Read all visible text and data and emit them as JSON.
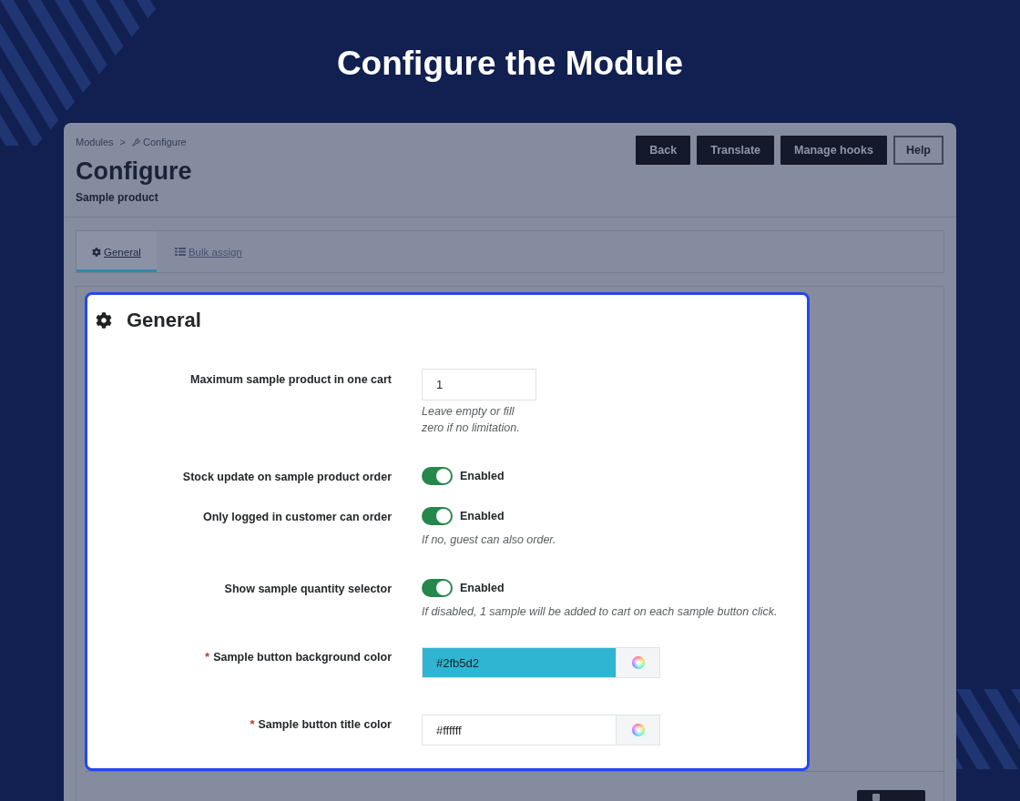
{
  "page": {
    "title": "Configure the Module"
  },
  "header": {
    "breadcrumb": [
      {
        "label": "Modules"
      },
      {
        "label": "Configure"
      }
    ],
    "separator": ">",
    "title": "Configure",
    "subtitle": "Sample product"
  },
  "toolbar": [
    {
      "label": "Back",
      "kind": "solid"
    },
    {
      "label": "Translate",
      "kind": "solid"
    },
    {
      "label": "Manage hooks",
      "kind": "solid"
    },
    {
      "label": "Help",
      "kind": "outline"
    }
  ],
  "tabs": [
    {
      "label": "General",
      "selected": true
    },
    {
      "label": "Bulk assign",
      "selected": false
    }
  ],
  "panel": {
    "title": "General",
    "fields": [
      {
        "kind": "number",
        "label": "Maximum sample product in one cart",
        "value": "1",
        "help": "Leave empty or fill zero if no limitation."
      },
      {
        "kind": "switch",
        "label": "Stock update on sample product order",
        "on": true,
        "state_label": "Enabled"
      },
      {
        "kind": "switch",
        "label": "Only logged in customer can order",
        "on": true,
        "state_label": "Enabled",
        "help": "If no, guest can also order."
      },
      {
        "kind": "switch",
        "label": "Show sample quantity selector",
        "on": true,
        "state_label": "Enabled",
        "help": "If disabled, 1 sample will be added to cart on each sample button click."
      },
      {
        "kind": "color",
        "label": "Sample button background color",
        "required_mark": "*",
        "value": "#2fb5d2",
        "color": "#2fb5d2"
      },
      {
        "kind": "color",
        "label": "Sample button title color",
        "required_mark": "*",
        "value": "#ffffff",
        "color": "#ffffff"
      }
    ]
  }
}
